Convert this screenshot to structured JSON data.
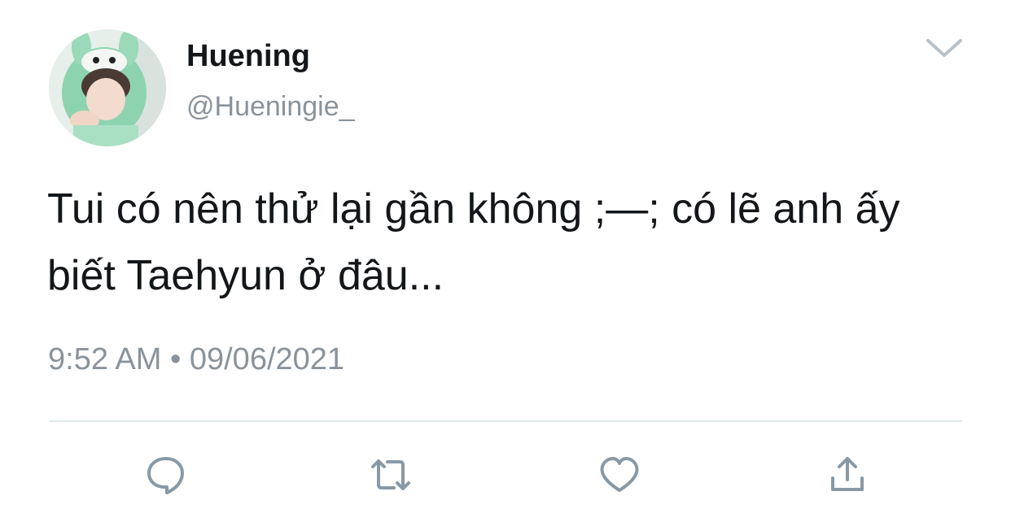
{
  "tweet": {
    "author": {
      "display_name": "Huening",
      "handle": "@Hueningie_",
      "avatar": "profile-photo"
    },
    "text": "Tui có nên thử lại gần không ;—; có lẽ anh ấy biết Taehyun ở đâu...",
    "time": "9:52 AM",
    "separator": "•",
    "date": "09/06/2021"
  },
  "actions": [
    {
      "name": "reply",
      "icon": "reply-bubble-icon"
    },
    {
      "name": "retweet",
      "icon": "retweet-icon"
    },
    {
      "name": "like",
      "icon": "heart-icon"
    },
    {
      "name": "share",
      "icon": "share-upload-icon"
    }
  ],
  "colors": {
    "text": "#14171a",
    "secondary": "#8a939b",
    "icon": "#8899a6",
    "divider": "#e1e8ed",
    "avatar_hood": "#8ed3b0"
  }
}
